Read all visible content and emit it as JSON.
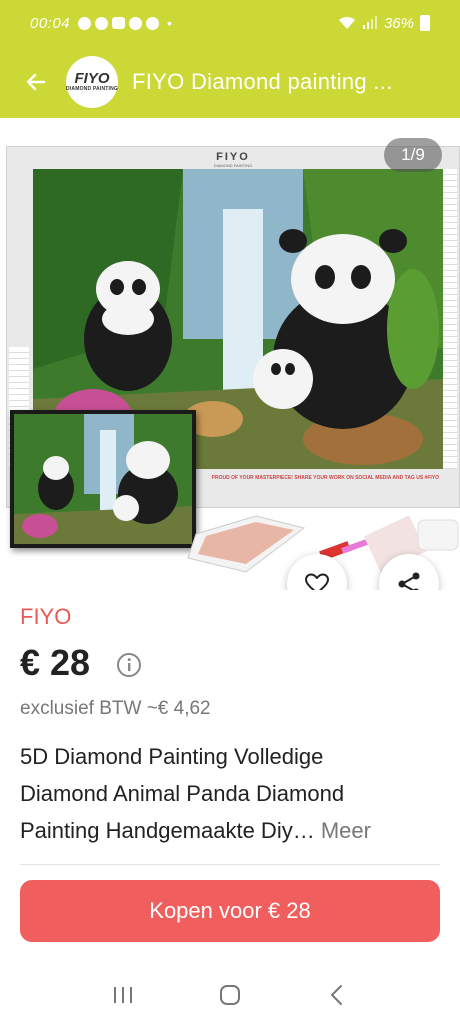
{
  "status_bar": {
    "time": "00:04",
    "battery": "36%",
    "icons": [
      "whatsapp-icon",
      "facebook-icon",
      "gallery-icon",
      "pinterest-icon",
      "pinterest-icon"
    ]
  },
  "app_bar": {
    "logo_text": "FIYO",
    "logo_subtext": "DIAMOND PAINTING",
    "title": "FIYO Diamond painting ..."
  },
  "product_image": {
    "counter": "1/9",
    "sheet_brand": "FIYO",
    "sheet_brand_sub": "DIAMOND PAINTING",
    "sheet_footer": "PROUD OF YOUR MASTERPIECE! SHARE YOUR WORK ON SOCIAL MEDIA AND TAG US #FIYO"
  },
  "product": {
    "seller": "FIYO",
    "price": "€ 28",
    "vat": "exclusief BTW ~€ 4,62",
    "title_lines": [
      "5D Diamond Painting Volledige",
      "Diamond Animal Panda Diamond",
      "Painting Handgemaakte Diy…"
    ],
    "more_label": "Meer"
  },
  "cta": {
    "buy_label": "Kopen voor € 28"
  },
  "colors": {
    "brand_bar": "#cbd836",
    "accent_red": "#f05f5d",
    "seller_red": "#e85a56"
  }
}
